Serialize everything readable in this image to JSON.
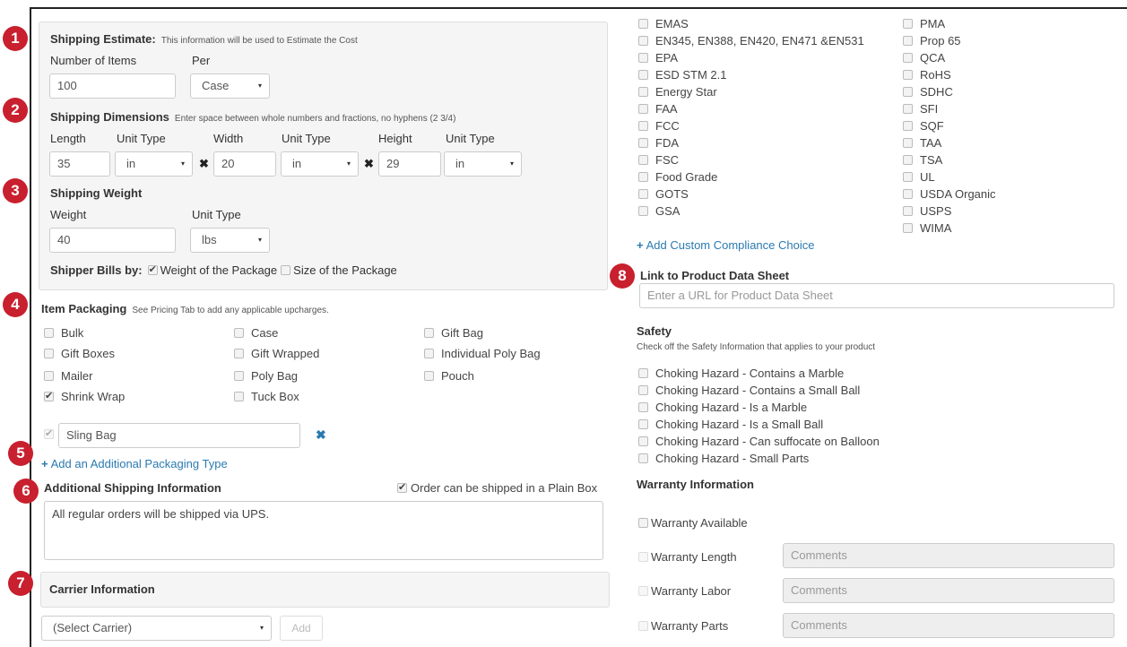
{
  "badges": [
    "1",
    "2",
    "3",
    "4",
    "5",
    "6",
    "7",
    "8"
  ],
  "shipping_estimate": {
    "title": "Shipping Estimate:",
    "hint": "This information will be used to Estimate the Cost",
    "items_label": "Number of Items",
    "per_label": "Per",
    "items_value": "100",
    "per_value": "Case"
  },
  "dimensions": {
    "title": "Shipping Dimensions",
    "hint": "Enter space between whole numbers and fractions, no hyphens (2 3/4)",
    "length_label": "Length",
    "width_label": "Width",
    "height_label": "Height",
    "unit_label": "Unit Type",
    "length_value": "35",
    "width_value": "20",
    "height_value": "29",
    "unit_value": "in",
    "times": "✖"
  },
  "weight": {
    "title": "Shipping Weight",
    "weight_label": "Weight",
    "unit_label": "Unit Type",
    "weight_value": "40",
    "unit_value": "lbs",
    "bills_label": "Shipper Bills by:",
    "option_weight": "Weight of the Package",
    "option_size": "Size of the Package"
  },
  "packaging": {
    "title": "Item Packaging",
    "hint": "See Pricing Tab to add any applicable upcharges.",
    "items": [
      "Bulk",
      "Case",
      "Gift Bag",
      "Gift Boxes",
      "Gift Wrapped",
      "Individual Poly Bag",
      "Mailer",
      "Poly Bag",
      "Pouch",
      "Shrink Wrap",
      "Tuck Box"
    ],
    "custom_value": "Sling Bag",
    "remove_icon": "✖",
    "add_link": "Add an Additional Packaging Type"
  },
  "additional": {
    "title": "Additional Shipping Information",
    "plain_box": "Order can be shipped in a Plain Box",
    "notes": "All regular orders will be shipped via UPS."
  },
  "carrier": {
    "title": "Carrier Information",
    "select_value": "(Select Carrier)",
    "add_label": "Add"
  },
  "compliance": {
    "col1": [
      "EMAS",
      "EN345, EN388, EN420, EN471 &EN531",
      "EPA",
      "ESD STM 2.1",
      "Energy Star",
      "FAA",
      "FCC",
      "FDA",
      "FSC",
      "Food Grade",
      "GOTS",
      "GSA"
    ],
    "col2": [
      "PMA",
      "Prop 65",
      "QCA",
      "RoHS",
      "SDHC",
      "SFI",
      "SQF",
      "TAA",
      "TSA",
      "UL",
      "USDA Organic",
      "USPS",
      "WIMA"
    ],
    "add_link": "Add Custom Compliance Choice"
  },
  "datasheet": {
    "title": "Link to Product Data Sheet",
    "placeholder": "Enter a URL for Product Data Sheet"
  },
  "safety": {
    "title": "Safety",
    "hint": "Check off the Safety Information that applies to your product",
    "items": [
      "Choking Hazard - Contains a Marble",
      "Choking Hazard - Contains a Small Ball",
      "Choking Hazard - Is a Marble",
      "Choking Hazard - Is a Small Ball",
      "Choking Hazard - Can suffocate on Balloon",
      "Choking Hazard - Small Parts"
    ]
  },
  "warranty": {
    "title": "Warranty Information",
    "available": "Warranty Available",
    "length": "Warranty Length",
    "labor": "Warranty Labor",
    "parts": "Warranty Parts",
    "comments": "Comments"
  },
  "colors": {
    "badge": "#c8202e",
    "link": "#2a7ab0"
  },
  "icons": {
    "caret": "▾",
    "plus": "+",
    "check": "✔"
  }
}
